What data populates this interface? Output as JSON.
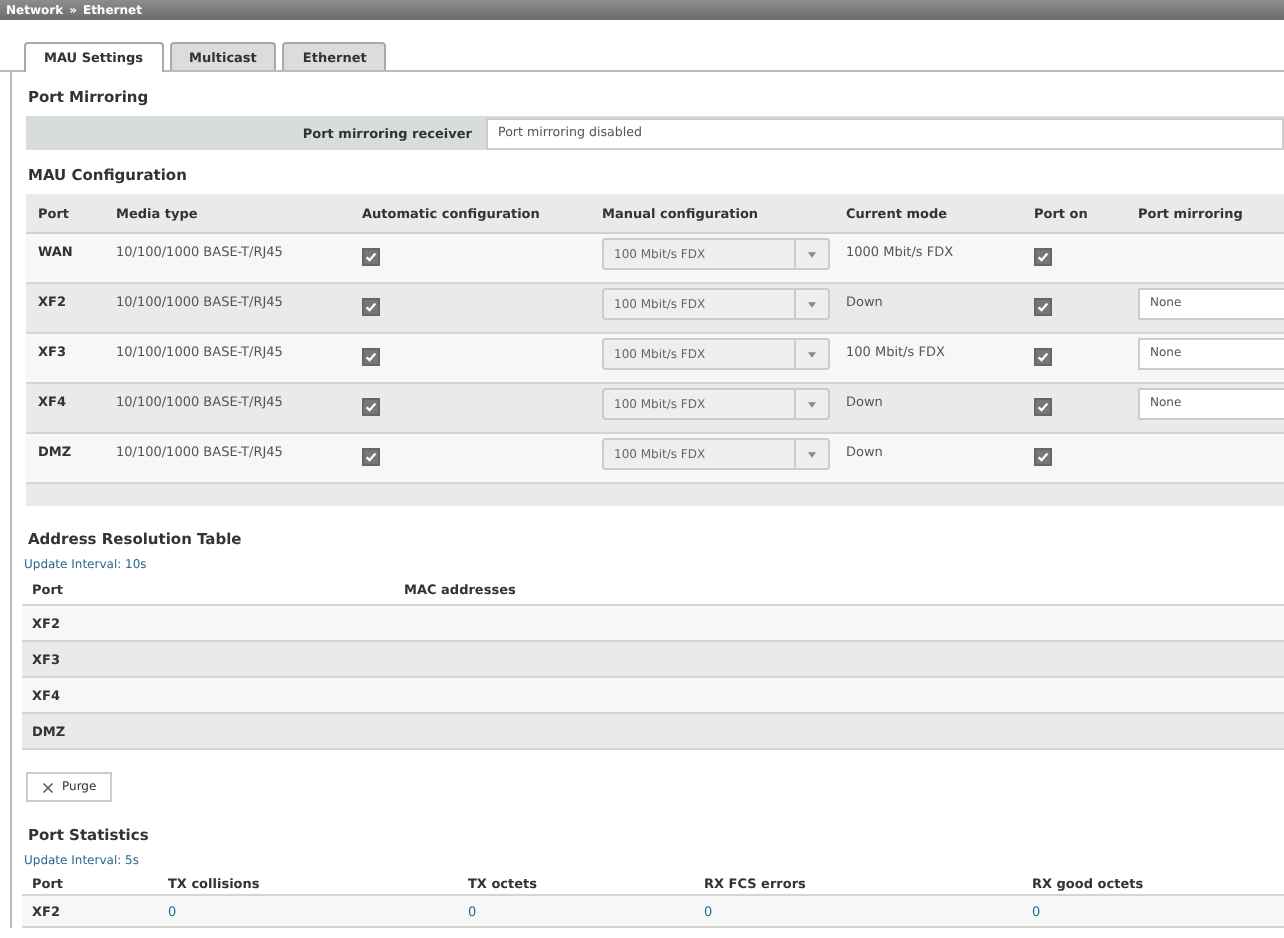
{
  "breadcrumb": [
    "Network",
    "»",
    "Ethernet"
  ],
  "tabs": [
    {
      "label": "MAU Settings",
      "selected": true
    },
    {
      "label": "Multicast",
      "selected": false
    },
    {
      "label": "Ethernet",
      "selected": false
    }
  ],
  "port_mirroring": {
    "title": "Port Mirroring",
    "label": "Port mirroring receiver",
    "value": "Port mirroring disabled"
  },
  "mau": {
    "title": "MAU Configuration",
    "columns": [
      "Port",
      "Media type",
      "Automatic configuration",
      "Manual configuration",
      "Current mode",
      "Port on",
      "Port mirroring"
    ],
    "rows": [
      {
        "port": "WAN",
        "media": "10/100/1000 BASE-T/RJ45",
        "auto": true,
        "manual": "100 Mbit/s FDX",
        "manual_disabled": true,
        "mode": "1000 Mbit/s FDX",
        "on": true
      },
      {
        "port": "XF2",
        "media": "10/100/1000 BASE-T/RJ45",
        "auto": true,
        "manual": "100 Mbit/s FDX",
        "manual_disabled": true,
        "mode": "Down",
        "on": true,
        "mirroring": "None"
      },
      {
        "port": "XF3",
        "media": "10/100/1000 BASE-T/RJ45",
        "auto": true,
        "manual": "100 Mbit/s FDX",
        "manual_disabled": true,
        "mode": "100 Mbit/s FDX",
        "on": true,
        "mirroring": "None"
      },
      {
        "port": "XF4",
        "media": "10/100/1000 BASE-T/RJ45",
        "auto": true,
        "manual": "100 Mbit/s FDX",
        "manual_disabled": true,
        "mode": "Down",
        "on": true,
        "mirroring": "None"
      },
      {
        "port": "DMZ",
        "media": "10/100/1000 BASE-T/RJ45",
        "auto": true,
        "manual": "100 Mbit/s FDX",
        "manual_disabled": true,
        "mode": "Down",
        "on": true
      }
    ]
  },
  "arp": {
    "title": "Address Resolution Table",
    "interval": "Update Interval: 10s",
    "columns": [
      "Port",
      "MAC addresses"
    ],
    "rows": [
      {
        "port": "XF2"
      },
      {
        "port": "XF3"
      },
      {
        "port": "XF4"
      },
      {
        "port": "DMZ"
      }
    ],
    "purge": "Purge"
  },
  "stats": {
    "title": "Port Statistics",
    "interval": "Update Interval: 5s",
    "columns": [
      "Port",
      "TX collisions",
      "TX octets",
      "RX FCS errors",
      "RX good octets"
    ],
    "rows": [
      [
        "XF2",
        "0",
        "0",
        "0",
        "0"
      ]
    ]
  }
}
